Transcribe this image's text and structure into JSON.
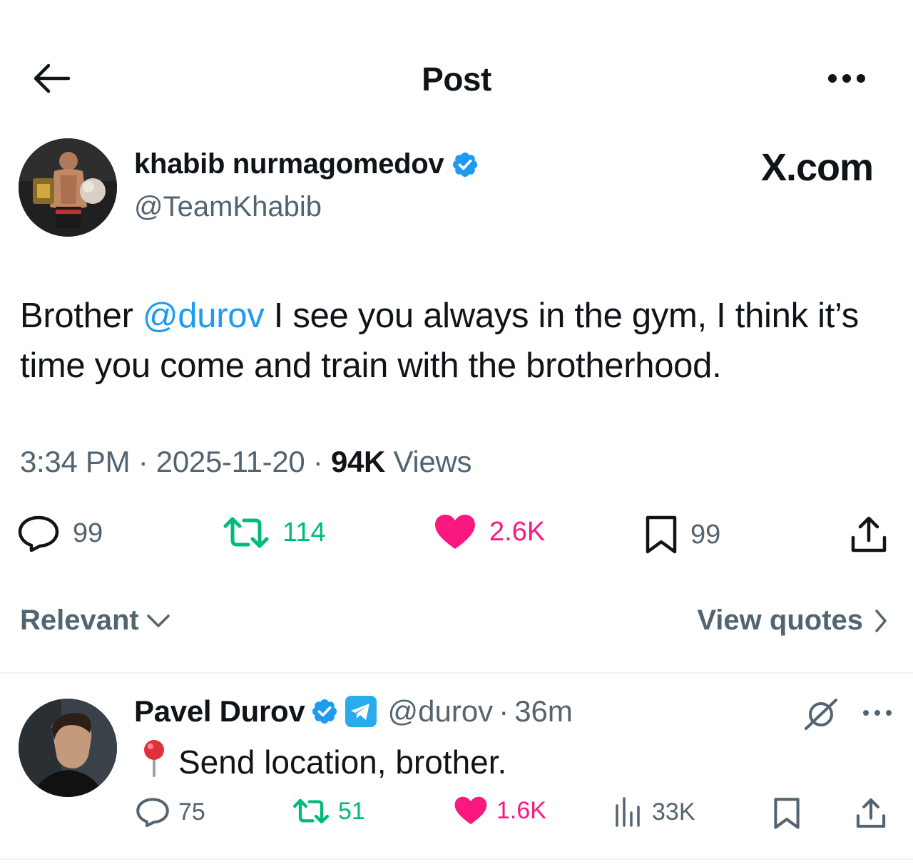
{
  "header": {
    "title": "Post",
    "back_icon": "arrow-left-icon",
    "more_icon": "more-horizontal-icon"
  },
  "author": {
    "name": "khabib nurmagomedov",
    "handle": "@TeamKhabib",
    "verified": true,
    "avatar_icon": "profile-photo"
  },
  "brand": "X.com",
  "post": {
    "text_before": "Brother ",
    "mention": "@durov",
    "text_after": " I see you always in the gym, I think it’s time you come and train with the brotherhood.",
    "time": "3:34 PM",
    "date": "2025-11-20",
    "views_count": "94K",
    "views_label": "Views",
    "separator": "·"
  },
  "actions": {
    "replies": "99",
    "reposts": "114",
    "likes": "2.6K",
    "bookmarks": "99"
  },
  "filters": {
    "sort_label": "Relevant",
    "view_quotes": "View quotes"
  },
  "reply": {
    "name": "Pavel Durov",
    "handle": "@durov",
    "time": "36m",
    "separator": "·",
    "emoji": "📍",
    "text": "Send location, brother.",
    "replies": "75",
    "reposts": "51",
    "likes": "1.6K",
    "views": "33K"
  },
  "colors": {
    "text_primary": "#0f1419",
    "text_secondary": "#536471",
    "link_blue": "#1d9bf0",
    "repost_green": "#00ba7c",
    "like_pink": "#f91880",
    "verified_blue": "#1d9bf0",
    "telegram_blue": "#2aabee"
  }
}
